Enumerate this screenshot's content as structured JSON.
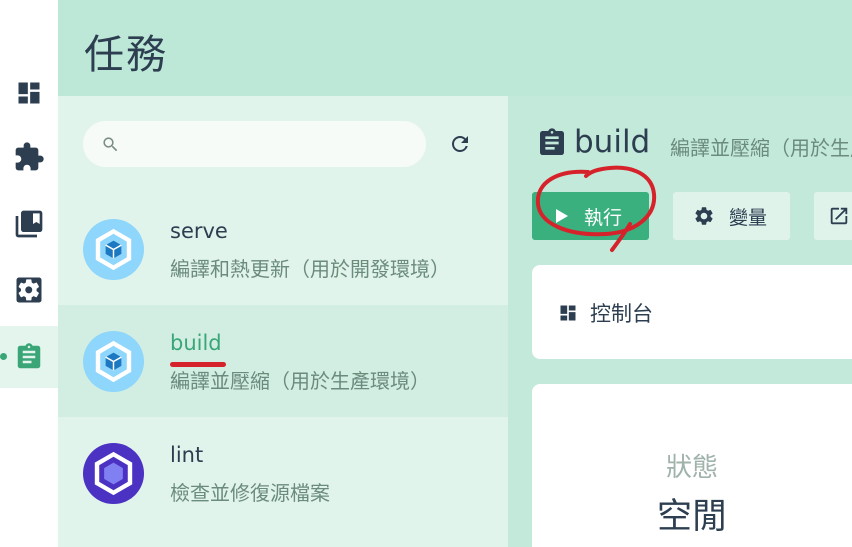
{
  "header": {
    "title": "任務"
  },
  "rail": {
    "items": [
      {
        "icon": "dashboard-icon"
      },
      {
        "icon": "plugins-icon"
      },
      {
        "icon": "dependencies-icon"
      },
      {
        "icon": "configuration-icon"
      },
      {
        "icon": "tasks-icon",
        "active": true
      }
    ]
  },
  "search": {
    "placeholder": ""
  },
  "tasks": [
    {
      "name": "serve",
      "description": "編譯和熱更新（用於開發環境）",
      "icon": "webpack-icon"
    },
    {
      "name": "build",
      "description": "編譯並壓縮（用於生產環境）",
      "icon": "webpack-icon",
      "selected": true
    },
    {
      "name": "lint",
      "description": "檢查並修復源檔案",
      "icon": "eslint-icon"
    }
  ],
  "details": {
    "name": "build",
    "description": "編譯並壓縮（用於生產環境）",
    "run_label": "執行",
    "vars_label": "變量",
    "console_label": "控制台",
    "status_label": "狀態",
    "status_value": "空閒"
  },
  "colors": {
    "accent": "#3aa678",
    "header_bg": "#bde8d7",
    "annotation": "#d6222a"
  }
}
